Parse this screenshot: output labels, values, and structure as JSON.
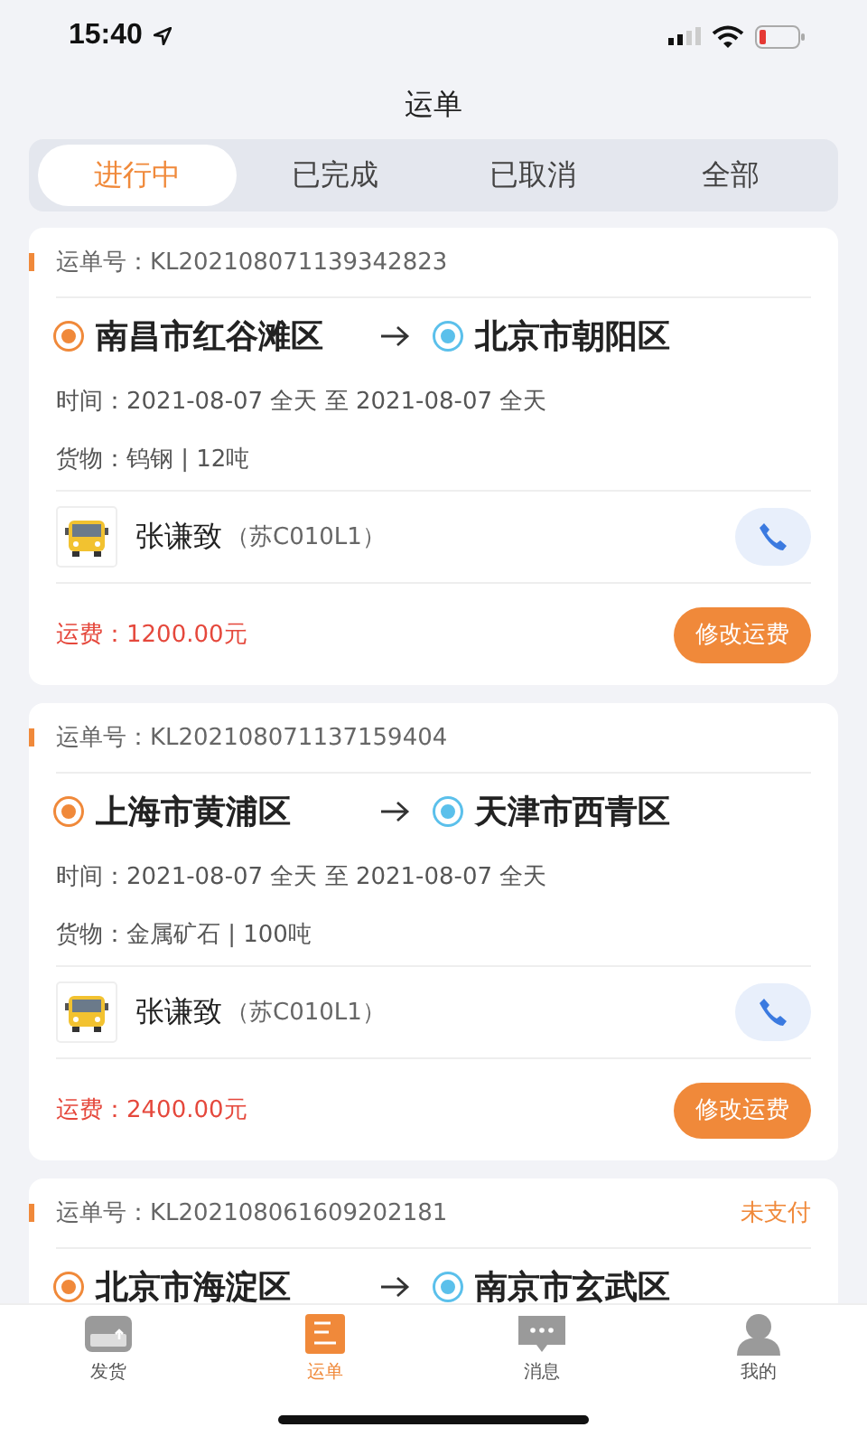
{
  "status_bar": {
    "time": "15:40"
  },
  "title": "运单",
  "tabs": [
    {
      "label": "进行中",
      "selected": true
    },
    {
      "label": "已完成",
      "selected": false
    },
    {
      "label": "已取消",
      "selected": false
    },
    {
      "label": "全部",
      "selected": false
    }
  ],
  "orders": [
    {
      "order_no": "运单号：KL202108071139342823",
      "from": "南昌市红谷滩区",
      "to": "北京市朝阳区",
      "time": "时间：2021-08-07 全天 至 2021-08-07 全天",
      "cargo": "货物：钨钢 | 12吨",
      "driver": "张谦致",
      "plate": "（苏C010L1）",
      "fee": "运费：1200.00元",
      "action": "修改运费"
    },
    {
      "order_no": "运单号：KL202108071137159404",
      "from": "上海市黄浦区",
      "to": "天津市西青区",
      "time": "时间：2021-08-07 全天 至 2021-08-07 全天",
      "cargo": "货物：金属矿石 | 100吨",
      "driver": "张谦致",
      "plate": "（苏C010L1）",
      "fee": "运费：2400.00元",
      "action": "修改运费"
    },
    {
      "order_no": "运单号：KL202108061609202181",
      "status": "未支付",
      "from": "北京市海淀区",
      "to": "南京市玄武区"
    }
  ],
  "nav": [
    {
      "label": "发货",
      "kind": "ship",
      "selected": false
    },
    {
      "label": "运单",
      "kind": "orders",
      "selected": true
    },
    {
      "label": "消息",
      "kind": "messages",
      "selected": false
    },
    {
      "label": "我的",
      "kind": "profile",
      "selected": false
    }
  ]
}
